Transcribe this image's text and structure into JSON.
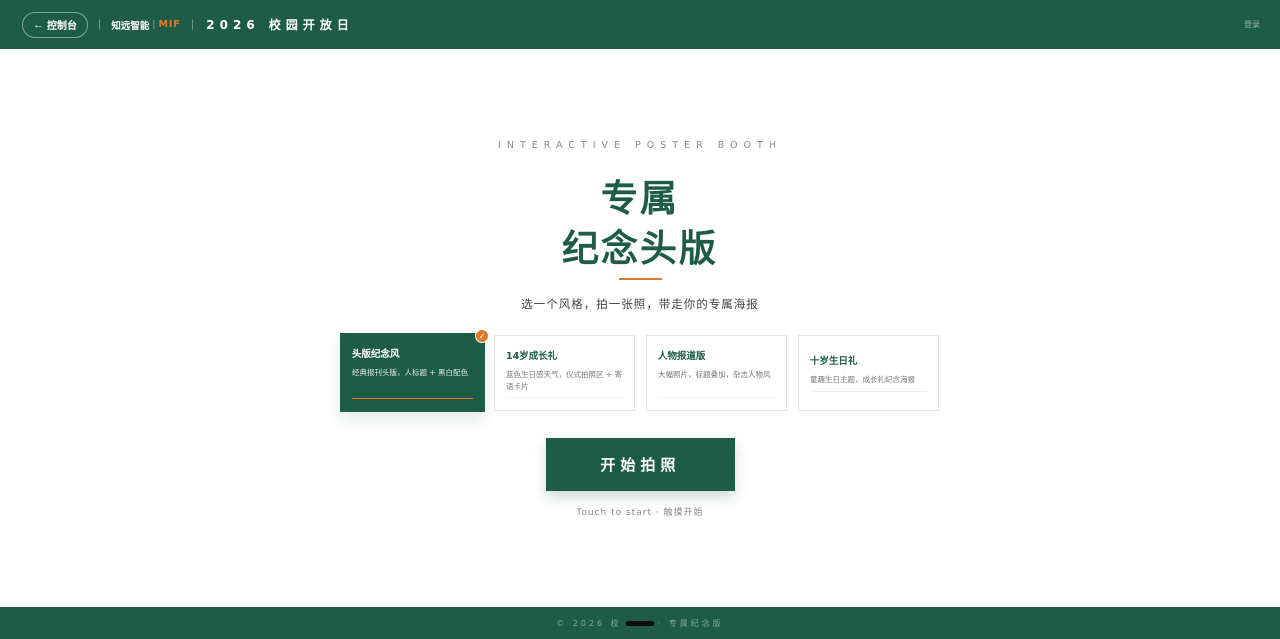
{
  "header": {
    "back_label": "控制台",
    "brand": "知远智能",
    "brand_code": "MIF",
    "event_title": "2026 校园开放日",
    "login": "登录"
  },
  "hero": {
    "eyebrow": "INTERACTIVE POSTER BOOTH",
    "title_line1": "专属",
    "title_line2": "纪念头版",
    "subtitle": "选一个风格，拍一张照，带走你的专属海报"
  },
  "styles": [
    {
      "title": "头版纪念风",
      "desc": "经典报刊头版，人标题 + 黑白配色",
      "selected": true
    },
    {
      "title": "14岁成长礼",
      "desc": "蓝色生日感天气，仪式拍照区 + 寄语卡片",
      "selected": false
    },
    {
      "title": "人物报道版",
      "desc": "大幅照片，标题叠加，杂志人物风",
      "selected": false
    },
    {
      "title": "十岁生日礼",
      "desc": "童趣生日主题，成长礼纪念海报",
      "selected": false
    }
  ],
  "start": {
    "label": "开始拍照",
    "hint": "Touch to start · 触摸开始"
  },
  "footer": {
    "prefix": "© 2026 校",
    "suffix": "· 专属纪念版"
  },
  "colors": {
    "brand_green": "#1e5c48",
    "accent_orange": "#e07a2a"
  },
  "icons": {
    "back": "arrow-left-icon",
    "selected": "check-icon"
  }
}
